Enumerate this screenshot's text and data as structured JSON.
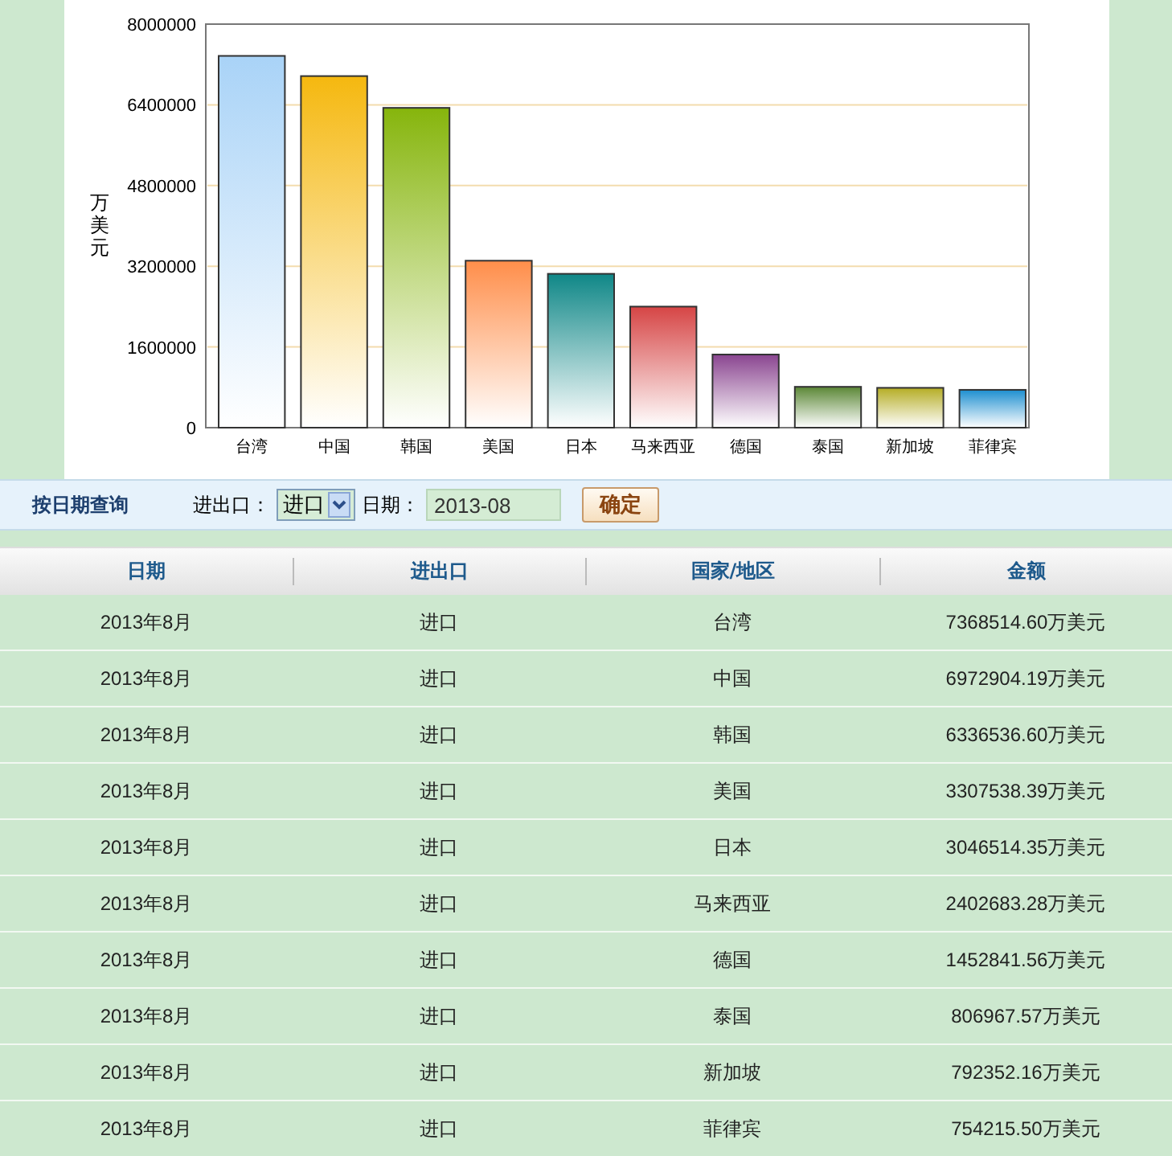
{
  "chart": {
    "chart_data": {
      "type": "bar",
      "ylabel": "万美元",
      "categories": [
        "台湾",
        "中国",
        "韩国",
        "美国",
        "日本",
        "马来西亚",
        "德国",
        "泰国",
        "新加坡",
        "菲律宾"
      ],
      "values": [
        7370000,
        6970000,
        6340000,
        3310000,
        3050000,
        2400000,
        1450000,
        810000,
        790000,
        750000
      ],
      "grid": true,
      "ylim": [
        0,
        8000000
      ],
      "yticks": [
        0,
        1600000,
        3200000,
        4800000,
        6400000,
        8000000
      ]
    }
  },
  "query": {
    "title": "按日期查询",
    "type_label": "进出口：",
    "type_value": "进口",
    "date_label": "日期：",
    "date_value": "2013-08",
    "submit": "确定"
  },
  "table": {
    "columns": [
      "日期",
      "进出口",
      "国家/地区",
      "金额"
    ],
    "rows": [
      [
        "2013年8月",
        "进口",
        "台湾",
        "7368514.60万美元"
      ],
      [
        "2013年8月",
        "进口",
        "中国",
        "6972904.19万美元"
      ],
      [
        "2013年8月",
        "进口",
        "韩国",
        "6336536.60万美元"
      ],
      [
        "2013年8月",
        "进口",
        "美国",
        "3307538.39万美元"
      ],
      [
        "2013年8月",
        "进口",
        "日本",
        "3046514.35万美元"
      ],
      [
        "2013年8月",
        "进口",
        "马来西亚",
        "2402683.28万美元"
      ],
      [
        "2013年8月",
        "进口",
        "德国",
        "1452841.56万美元"
      ],
      [
        "2013年8月",
        "进口",
        "泰国",
        "806967.57万美元"
      ],
      [
        "2013年8月",
        "进口",
        "新加坡",
        "792352.16万美元"
      ],
      [
        "2013年8月",
        "进口",
        "菲律宾",
        "754215.50万美元"
      ]
    ]
  }
}
